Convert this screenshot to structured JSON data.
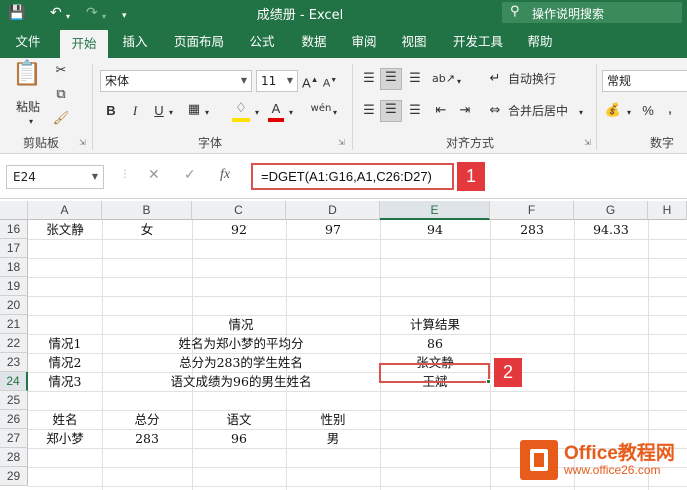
{
  "titlebar": {
    "title": "成绩册  -  Excel",
    "tell_me": "操作说明搜索",
    "save_icon": "save-icon",
    "undo_icon": "undo-icon",
    "redo_icon": "redo-icon"
  },
  "tabs": [
    "文件",
    "开始",
    "插入",
    "页面布局",
    "公式",
    "数据",
    "审阅",
    "视图",
    "开发工具",
    "帮助"
  ],
  "active_tab": "开始",
  "ribbon": {
    "clipboard_label": "剪贴板",
    "paste_label": "粘贴",
    "font_name": "宋体",
    "font_size": "11",
    "font_label": "字体",
    "bold": "B",
    "italic": "I",
    "underline": "U",
    "wrap_text": "自动换行",
    "merge_center": "合并后居中",
    "alignment_label": "对齐方式",
    "number_format": "常规",
    "number_label": "数字",
    "percent": "%",
    "comma": ","
  },
  "formula_bar": {
    "name_box": "E24",
    "fx": "fx",
    "formula": "=DGET(A1:G16,A1,C26:D27)"
  },
  "callouts": [
    "1",
    "2"
  ],
  "grid": {
    "columns": [
      "A",
      "B",
      "C",
      "D",
      "E",
      "F",
      "G",
      "H"
    ],
    "rows": [
      "16",
      "17",
      "18",
      "19",
      "20",
      "21",
      "22",
      "23",
      "24",
      "25",
      "26",
      "27",
      "28",
      "29"
    ],
    "selected_column": "E",
    "selected_row": "24",
    "cells": {
      "r16": {
        "A": "张文静",
        "B": "女",
        "C": "92",
        "D": "97",
        "E": "94",
        "F": "283",
        "G": "94.33"
      },
      "r21": {
        "C": "情况",
        "E": "计算结果"
      },
      "r22": {
        "A": "情况1",
        "C": "姓名为郑小梦的平均分",
        "E": "86"
      },
      "r23": {
        "A": "情况2",
        "C": "总分为283的学生姓名",
        "E": "张文静"
      },
      "r24": {
        "A": "情况3",
        "C": "语文成绩为96的男生姓名",
        "E": "王斌"
      },
      "r26": {
        "A": "姓名",
        "B": "总分",
        "C": "语文",
        "D": "性别"
      },
      "r27": {
        "A": "郑小梦",
        "B": "283",
        "C": "96",
        "D": "男"
      }
    }
  },
  "watermark": {
    "brand": "Office教程网",
    "url": "www.office26.com"
  }
}
